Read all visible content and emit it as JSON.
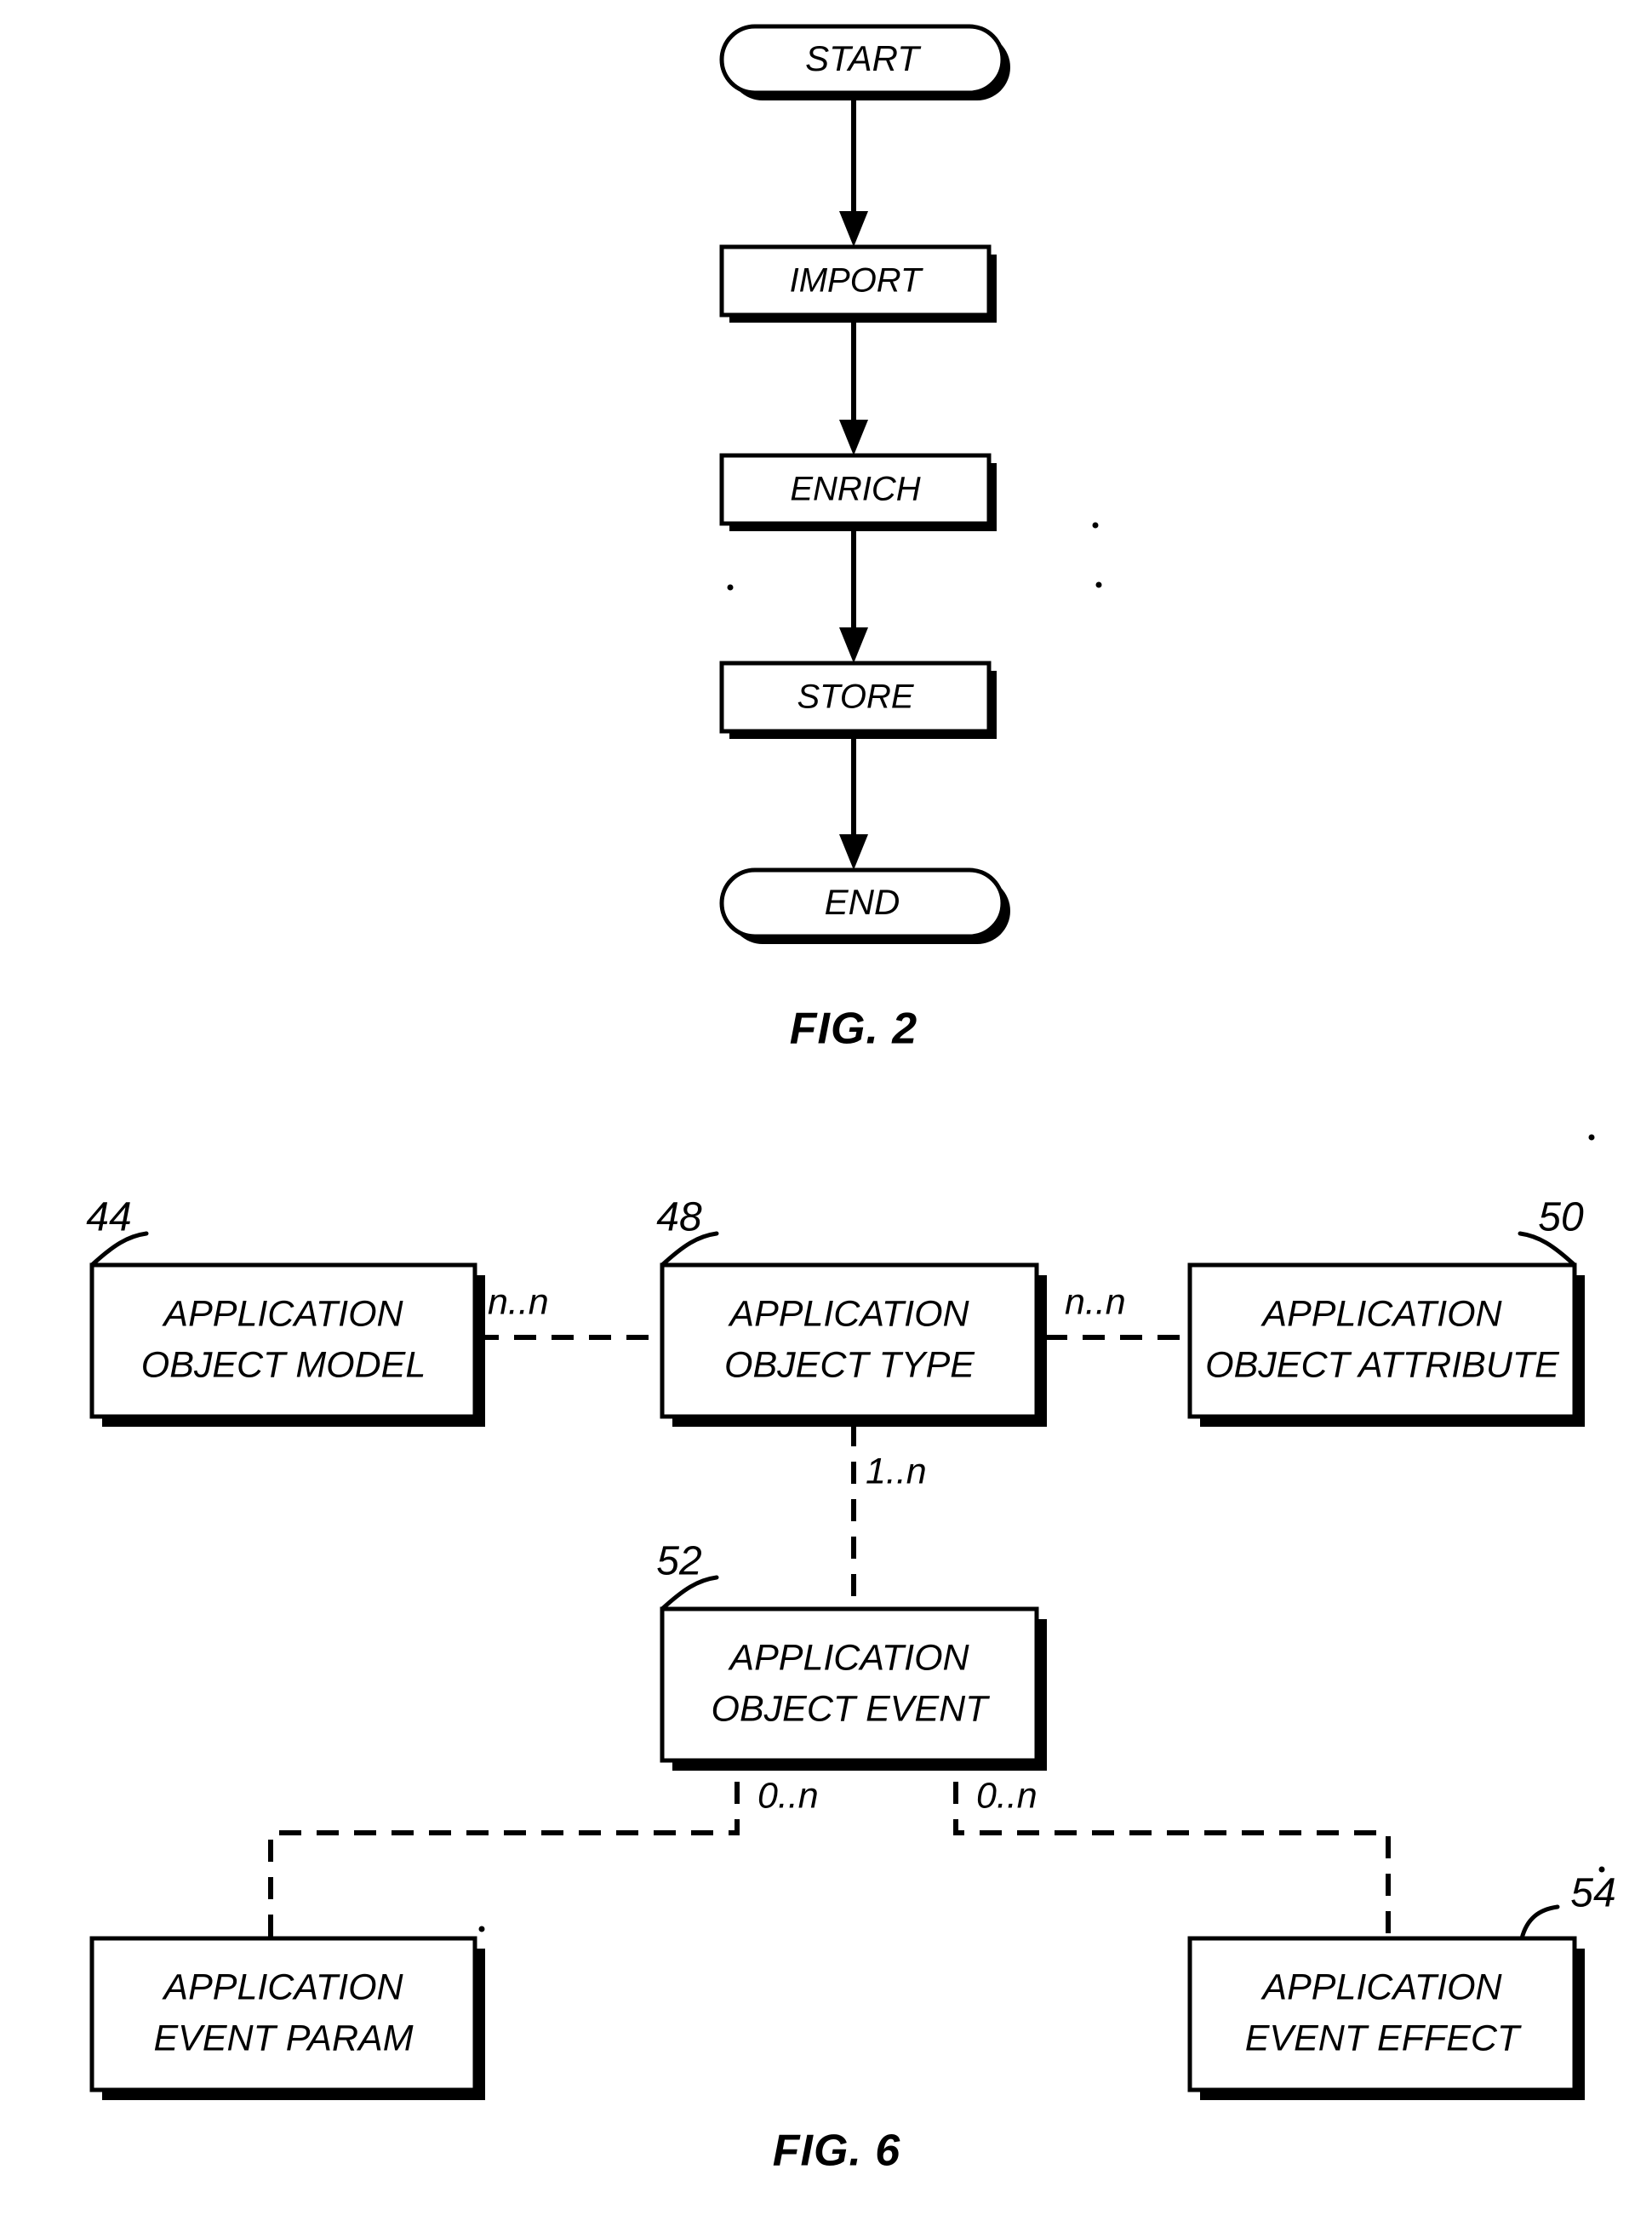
{
  "document": {
    "kind": "patent-drawing-sheet",
    "background_color": "#ffffff",
    "ink_color": "#000000"
  },
  "figures": [
    {
      "id": "fig2",
      "caption": "FIG. 2",
      "type": "flowchart",
      "nodes": [
        {
          "id": "start",
          "label": "START",
          "shape": "terminator"
        },
        {
          "id": "import",
          "label": "IMPORT",
          "shape": "process"
        },
        {
          "id": "enrich",
          "label": "ENRICH",
          "shape": "process"
        },
        {
          "id": "store",
          "label": "STORE",
          "shape": "process"
        },
        {
          "id": "end",
          "label": "END",
          "shape": "terminator"
        }
      ],
      "edges": [
        {
          "from": "start",
          "to": "import",
          "style": "solid-arrow"
        },
        {
          "from": "import",
          "to": "enrich",
          "style": "solid-arrow"
        },
        {
          "from": "enrich",
          "to": "store",
          "style": "solid-arrow"
        },
        {
          "from": "store",
          "to": "end",
          "style": "solid-arrow"
        }
      ]
    },
    {
      "id": "fig6",
      "caption": "FIG. 6",
      "type": "entity-relationship",
      "nodes": [
        {
          "id": "aom",
          "ref": "44",
          "line1": "APPLICATION",
          "line2": "OBJECT MODEL"
        },
        {
          "id": "aot",
          "ref": "48",
          "line1": "APPLICATION",
          "line2": "OBJECT TYPE"
        },
        {
          "id": "aoa",
          "ref": "50",
          "line1": "APPLICATION",
          "line2": "OBJECT ATTRIBUTE"
        },
        {
          "id": "aoe",
          "ref": "52",
          "line1": "APPLICATION",
          "line2": "OBJECT EVENT"
        },
        {
          "id": "aep",
          "ref": "",
          "line1": "APPLICATION",
          "line2": "EVENT PARAM"
        },
        {
          "id": "aee",
          "ref": "54",
          "line1": "APPLICATION",
          "line2": "EVENT EFFECT"
        }
      ],
      "edges": [
        {
          "from": "aom",
          "to": "aot",
          "cardinality": "n..n",
          "style": "dashed"
        },
        {
          "from": "aot",
          "to": "aoa",
          "cardinality": "n..n",
          "style": "dashed"
        },
        {
          "from": "aot",
          "to": "aoe",
          "cardinality": "1..n",
          "style": "dashed"
        },
        {
          "from": "aoe",
          "to": "aep",
          "cardinality": "0..n",
          "style": "dashed"
        },
        {
          "from": "aoe",
          "to": "aee",
          "cardinality": "0..n",
          "style": "dashed"
        }
      ]
    }
  ]
}
